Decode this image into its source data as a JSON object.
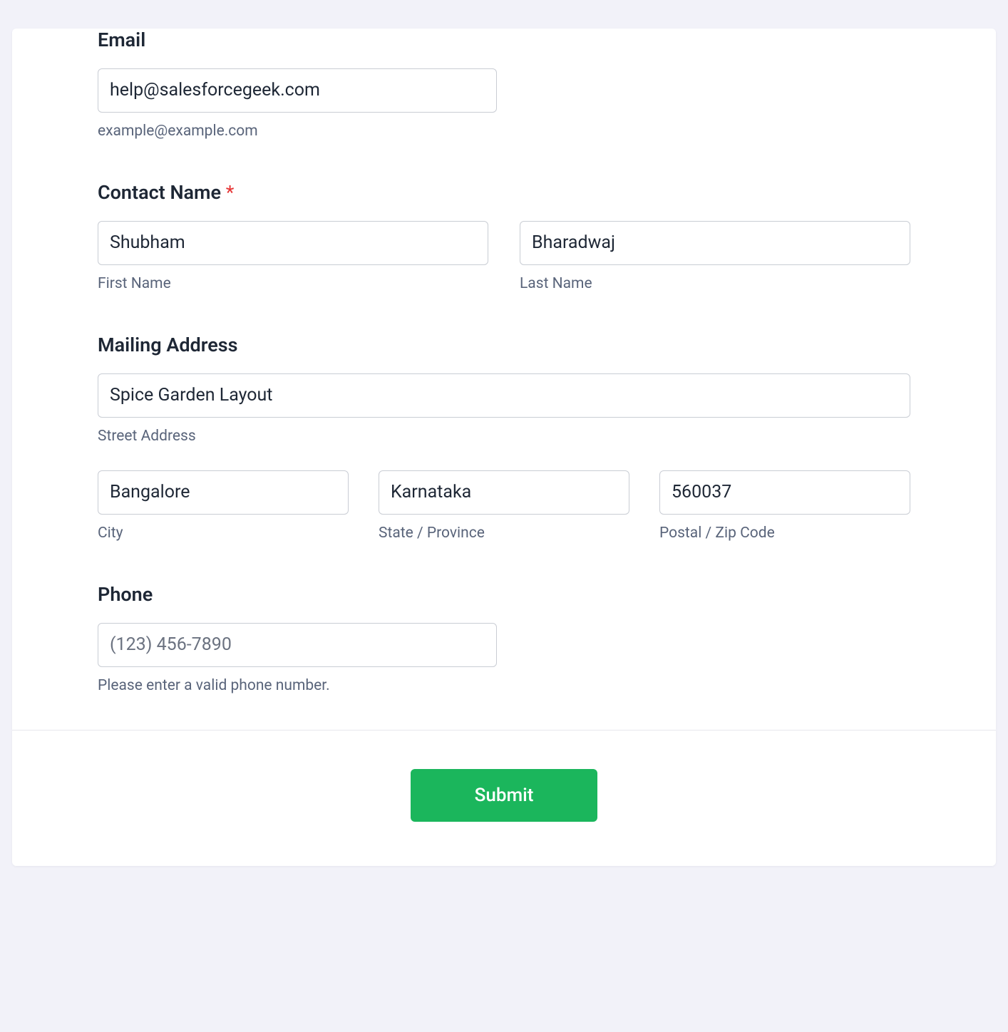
{
  "email": {
    "label": "Email",
    "value": "help@salesforcegeek.com",
    "help": "example@example.com"
  },
  "contact_name": {
    "label": "Contact Name ",
    "required": true,
    "first_name": {
      "value": "Shubham",
      "help": "First Name"
    },
    "last_name": {
      "value": "Bharadwaj",
      "help": "Last Name"
    }
  },
  "mailing_address": {
    "label": "Mailing Address",
    "street": {
      "value": "Spice Garden Layout",
      "help": "Street Address"
    },
    "city": {
      "value": "Bangalore",
      "help": "City"
    },
    "state": {
      "value": "Karnataka",
      "help": "State / Province"
    },
    "postal": {
      "value": "560037",
      "help": "Postal / Zip Code"
    }
  },
  "phone": {
    "label": "Phone",
    "placeholder": "(123) 456-7890",
    "value": "",
    "help": "Please enter a valid phone number."
  },
  "submit": {
    "label": "Submit"
  }
}
